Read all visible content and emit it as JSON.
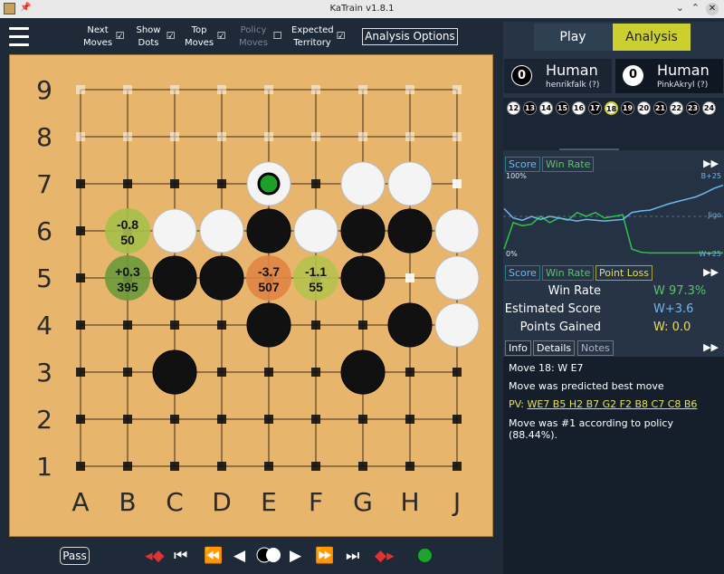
{
  "window": {
    "title": "KaTrain v1.8.1"
  },
  "toolbar": {
    "next_moves": "Next\nMoves",
    "show_dots": "Show\nDots",
    "top_moves": "Top\nMoves",
    "policy_moves": "Policy\nMoves",
    "expected_territory": "Expected\nTerritory",
    "analysis_options": "Analysis Options",
    "checked_mark": "☑",
    "unchecked_mark": "☐"
  },
  "mode_tabs": {
    "play": "Play",
    "analysis": "Analysis"
  },
  "players": {
    "black": {
      "captures": "0",
      "type": "Human",
      "user": "henrikfalk (?)"
    },
    "white": {
      "captures": "0",
      "type": "Human",
      "user": "PinkAkryl (?)"
    }
  },
  "timeline": {
    "moves": [
      "12",
      "13",
      "14",
      "15",
      "16",
      "17",
      "18",
      "19",
      "20",
      "21",
      "22",
      "23",
      "24"
    ],
    "current": "18"
  },
  "board": {
    "size": 9,
    "columns": [
      "A",
      "B",
      "C",
      "D",
      "E",
      "F",
      "G",
      "H",
      "J"
    ],
    "rows": [
      "9",
      "8",
      "7",
      "6",
      "5",
      "4",
      "3",
      "2",
      "1"
    ],
    "black_stones": [
      "E6",
      "D5",
      "C5",
      "G6",
      "H6",
      "G5",
      "E4",
      "H4",
      "C3",
      "G3"
    ],
    "white_stones": [
      "E7",
      "G7",
      "H7",
      "C6",
      "D6",
      "F6",
      "J6",
      "J5",
      "J4"
    ],
    "last_move": "E7",
    "candidates": [
      {
        "point": "B6",
        "score": "-0.8",
        "visits": "50",
        "color": "#a5c04a"
      },
      {
        "point": "B5",
        "score": "+0.3",
        "visits": "395",
        "color": "#6a9a3a"
      },
      {
        "point": "E5",
        "score": "-3.7",
        "visits": "507",
        "color": "#e08444"
      },
      {
        "point": "F5",
        "score": "-1.1",
        "visits": "55",
        "color": "#b5c24d"
      }
    ]
  },
  "controls": {
    "pass": "Pass"
  },
  "graph": {
    "tabs": [
      "Score",
      "Win Rate"
    ],
    "label_top_left": "100%",
    "label_bottom_left": "0%",
    "label_top_right": "B+25",
    "label_mid_right": "Jigo",
    "label_bottom_right": "W+25",
    "winrate_series": [
      0.08,
      0.42,
      0.38,
      0.4,
      0.5,
      0.42,
      0.48,
      0.45,
      0.55,
      0.5,
      0.55,
      0.48,
      0.5,
      0.52,
      0.08,
      0.04,
      0.03,
      0.03,
      0.03,
      0.03,
      0.03,
      0.03,
      0.03,
      0.03,
      0.03
    ],
    "score_series": [
      0.6,
      0.48,
      0.45,
      0.5,
      0.46,
      0.5,
      0.48,
      0.46,
      0.44,
      0.46,
      0.45,
      0.44,
      0.45,
      0.46,
      0.55,
      0.57,
      0.58,
      0.62,
      0.66,
      0.69,
      0.72,
      0.75,
      0.8,
      0.86,
      0.9
    ]
  },
  "stats": {
    "tabs": [
      "Score",
      "Win Rate",
      "Point Loss"
    ],
    "rows": [
      {
        "label": "Win Rate",
        "value": "W 97.3%",
        "color": "#5ec26a"
      },
      {
        "label": "Estimated Score",
        "value": "W+3.6",
        "color": "#6fb8ea"
      },
      {
        "label": "Points Gained",
        "value": "W: 0.0",
        "color": "#e8df5a"
      }
    ]
  },
  "info": {
    "tabs": [
      "Info",
      "Details",
      "Notes"
    ],
    "move": "Move 18: W E7",
    "predicted": "Move was predicted best move",
    "pv_label": "PV: ",
    "pv_moves": "WE7 B5 H2 B7 G2 F2 B8 C7 C8 B6",
    "policy_rank": "Move was #1 according to policy  (88.44%)."
  }
}
